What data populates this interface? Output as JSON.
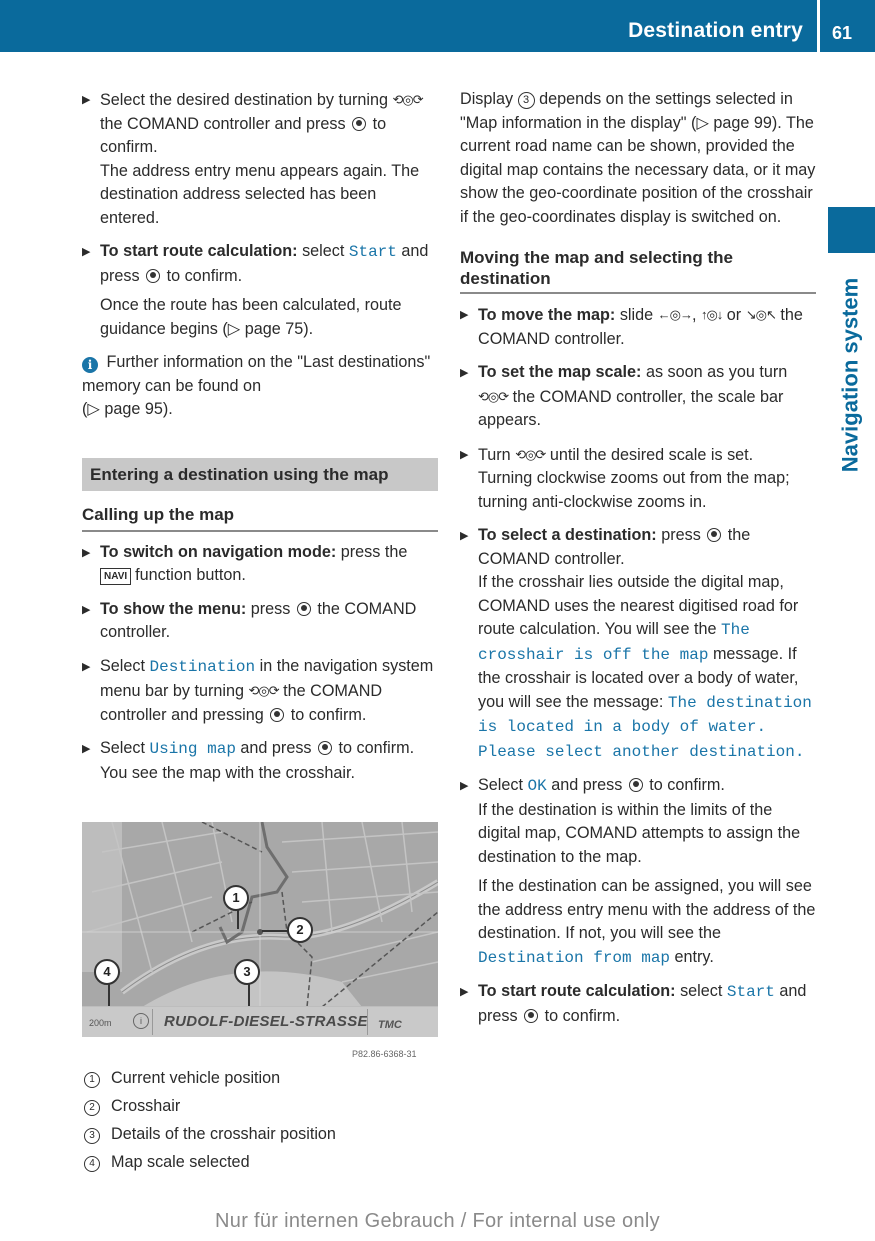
{
  "header": {
    "title": "Destination entry",
    "page_number": "61",
    "color": "#0a6a9c"
  },
  "side_tab": {
    "label": "Navigation system"
  },
  "left_column": {
    "step_select_destination": {
      "text_a": "Select the desired destination by turning",
      "text_b": "the COMAND controller and press",
      "text_c": "to confirm.",
      "result": "The address entry menu appears again. The destination address selected has been entered."
    },
    "step_start_route": {
      "bold": "To start route calculation:",
      "text_a": "select",
      "option": "Start",
      "text_b": "and press",
      "text_c": "to confirm.",
      "result_a": "Once the route has been calculated, route guidance begins (",
      "page_ref": "▷ page 75",
      "result_b": ")."
    },
    "info_note": {
      "icon": "info-icon",
      "text_a": "Further information on the \"Last destinations\" memory can be found on",
      "page_ref": "(▷ page 95)."
    },
    "section_title": "Entering a destination using the map",
    "subheading": "Calling up the map",
    "step_navi": {
      "bold": "To switch on navigation mode:",
      "text_a": "press the",
      "key": "NAVI",
      "text_b": "function button."
    },
    "step_menu": {
      "bold": "To show the menu:",
      "text_a": "press",
      "text_b": "the COMAND controller."
    },
    "step_destination": {
      "text_a": "Select",
      "option": "Destination",
      "text_b": "in the navigation system menu bar by turning",
      "text_c": "the COMAND controller and pressing",
      "text_d": "to confirm."
    },
    "step_using_map": {
      "text_a": "Select",
      "option": "Using map",
      "text_b": "and press",
      "text_c": "to confirm.",
      "result": "You see the map with the crosshair."
    },
    "figure": {
      "scale": "200m",
      "street": "RUDOLF-DIESEL-STRASSE",
      "tmc": "TMC",
      "info_glyph": "i",
      "callouts": [
        "1",
        "2",
        "3",
        "4"
      ],
      "code": "P82.86-6368-31"
    },
    "legend": [
      {
        "num": "1",
        "label": "Current vehicle position"
      },
      {
        "num": "2",
        "label": "Crosshair"
      },
      {
        "num": "3",
        "label": "Details of the crosshair position"
      },
      {
        "num": "4",
        "label": "Map scale selected"
      }
    ]
  },
  "right_column": {
    "display_para": {
      "text_a": "Display",
      "num": "3",
      "text_b": "depends on the settings selected in \"Map information in the display\" (",
      "page_ref": "▷ page 99",
      "text_c": "). The current road name can be shown, provided the digital map contains the necessary data, or it may show the geo-coordinate position of the crosshair if the geo-coordinates display is switched on."
    },
    "subheading": "Moving the map and selecting the destination",
    "step_move": {
      "bold": "To move the map:",
      "text_a": "slide",
      "glyph_lr": "←◎→",
      "glyph_ud": "↑◎↓",
      "text_b": "or",
      "glyph_diag": "↘◎↖",
      "text_c": "the COMAND controller."
    },
    "step_scale": {
      "bold": "To set the map scale:",
      "text_a": "as soon as you turn",
      "text_b": "the COMAND controller, the scale bar appears."
    },
    "step_turn": {
      "text_a": "Turn",
      "text_b": "until the desired scale is set.",
      "result": "Turning clockwise zooms out from the map; turning anti-clockwise zooms in."
    },
    "step_select_dest": {
      "bold": "To select a destination:",
      "text_a": "press",
      "text_b": "the COMAND controller.",
      "result_a": "If the crosshair lies outside the digital map, COMAND uses the nearest digitised road for route calculation. You will see the",
      "msg_off_map": "The crosshair is off the map",
      "result_b": "message. If the crosshair is located over a body of water, you will see the message:",
      "msg_water": "The destination is located in a body of water. Please select another destination."
    },
    "step_ok": {
      "text_a": "Select",
      "option": "OK",
      "text_b": "and press",
      "text_c": "to confirm.",
      "result_a": "If the destination is within the limits of the digital map, COMAND attempts to assign the destination to the map.",
      "result_b": "If the destination can be assigned, you will see the address entry menu with the address of the destination. If not, you will see the",
      "entry": "Destination from map",
      "result_c": "entry."
    },
    "step_start_route": {
      "bold": "To start route calculation:",
      "text_a": "select",
      "option": "Start",
      "text_b": "and press",
      "text_c": "to confirm."
    }
  },
  "glyphs": {
    "bullet": "▶",
    "turn": "⟲◎⟳"
  },
  "footer": {
    "text": "Nur für internen Gebrauch / For internal use only"
  }
}
